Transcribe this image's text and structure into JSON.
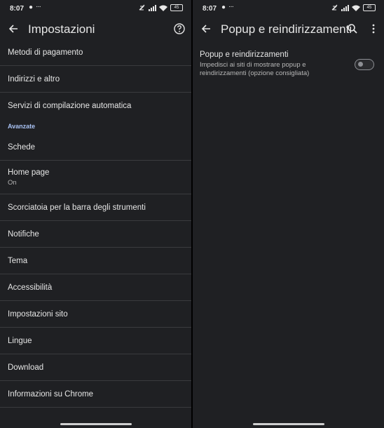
{
  "status_left": {
    "time": "8:07",
    "battery": "45"
  },
  "status_right": {
    "time": "8:07",
    "battery": "45"
  },
  "settings": {
    "title": "Impostazioni",
    "items_top": [
      {
        "label": "Metodi di pagamento"
      },
      {
        "label": "Indirizzi e altro"
      },
      {
        "label": "Servizi di compilazione automatica"
      }
    ],
    "section_advanced": "Avanzate",
    "items_advanced": [
      {
        "label": "Schede"
      },
      {
        "label": "Home page",
        "sub": "On"
      },
      {
        "label": "Scorciatoia per la barra degli strumenti"
      },
      {
        "label": "Notifiche"
      },
      {
        "label": "Tema"
      },
      {
        "label": "Accessibilità"
      },
      {
        "label": "Impostazioni sito"
      },
      {
        "label": "Lingue"
      },
      {
        "label": "Download"
      },
      {
        "label": "Informazioni su Chrome"
      }
    ]
  },
  "popups": {
    "title": "Popup e reindirizzamenti",
    "pref_title": "Popup e reindirizzamenti",
    "pref_desc": "Impedisci ai siti di mostrare popup e reindirizzamenti (opzione consigliata)",
    "toggle_on": false
  },
  "colors": {
    "background": "#1f2023",
    "section_header": "#a9c2f4",
    "divider": "#3a3b3e"
  }
}
